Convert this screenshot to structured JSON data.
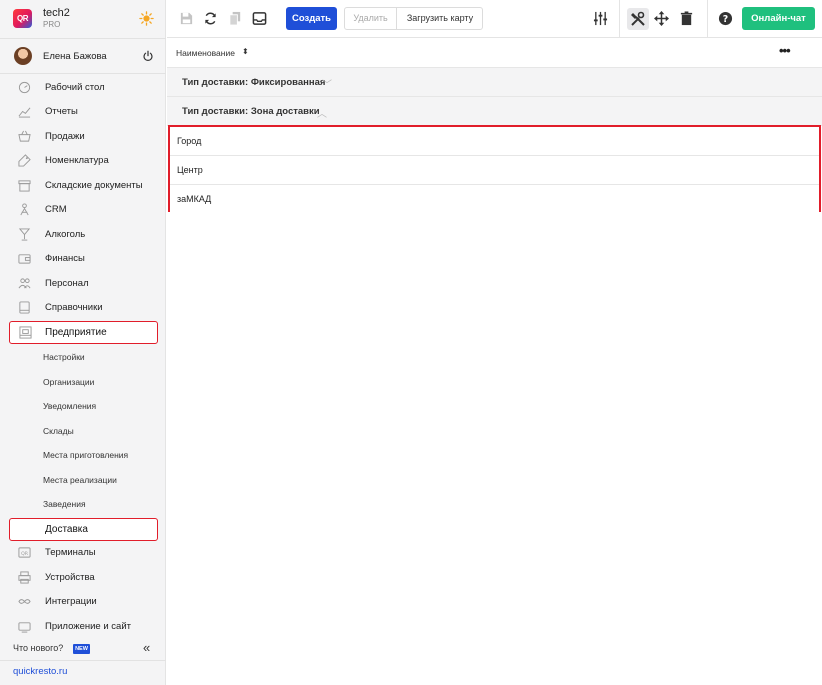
{
  "brand": {
    "logo_text": "QR",
    "name": "tech2",
    "plan": "PRO"
  },
  "user": {
    "name": "Елена Бажова"
  },
  "nav": {
    "items": [
      {
        "label": "Рабочий стол",
        "icon": "dashboard-icon"
      },
      {
        "label": "Отчеты",
        "icon": "reports-icon"
      },
      {
        "label": "Продажи",
        "icon": "basket-icon"
      },
      {
        "label": "Номенклатура",
        "icon": "tag-icon"
      },
      {
        "label": "Складские документы",
        "icon": "warehouse-box-icon"
      },
      {
        "label": "CRM",
        "icon": "crm-icon"
      },
      {
        "label": "Алкоголь",
        "icon": "glass-icon"
      },
      {
        "label": "Финансы",
        "icon": "wallet-icon"
      },
      {
        "label": "Персонал",
        "icon": "people-icon"
      },
      {
        "label": "Справочники",
        "icon": "book-icon"
      }
    ],
    "active_section": {
      "label": "Предприятие",
      "icon": "building-icon"
    },
    "sub_items": [
      "Настройки",
      "Организации",
      "Уведомления",
      "Склады",
      "Места приготовления",
      "Места реализации",
      "Заведения"
    ],
    "active_sub_item": "Доставка",
    "items_after": [
      {
        "label": "Терминалы",
        "icon": "terminal-icon"
      },
      {
        "label": "Устройства",
        "icon": "printer-icon"
      },
      {
        "label": "Интеграции",
        "icon": "infinity-icon"
      },
      {
        "label": "Приложение и сайт",
        "icon": "app-icon"
      }
    ],
    "whats_new": "Что нового?",
    "new_badge": "NEW",
    "site_link": "quickresto.ru"
  },
  "toolbar": {
    "create_label": "Создать",
    "delete_label": "Удалить",
    "load_map_label": "Загрузить карту",
    "chat_label": "Онлайн-чат"
  },
  "table": {
    "column_name": "Наименование",
    "groups": [
      {
        "label": "Тип доставки: Фиксированная",
        "expanded": false
      },
      {
        "label": "Тип доставки: Зона доставки",
        "expanded": true
      }
    ],
    "rows": [
      "Город",
      "Центр",
      "заМКАД"
    ]
  },
  "colors": {
    "accent": "#1f4fd8",
    "chat": "#1fc07e",
    "highlight": "#e11d2a"
  }
}
